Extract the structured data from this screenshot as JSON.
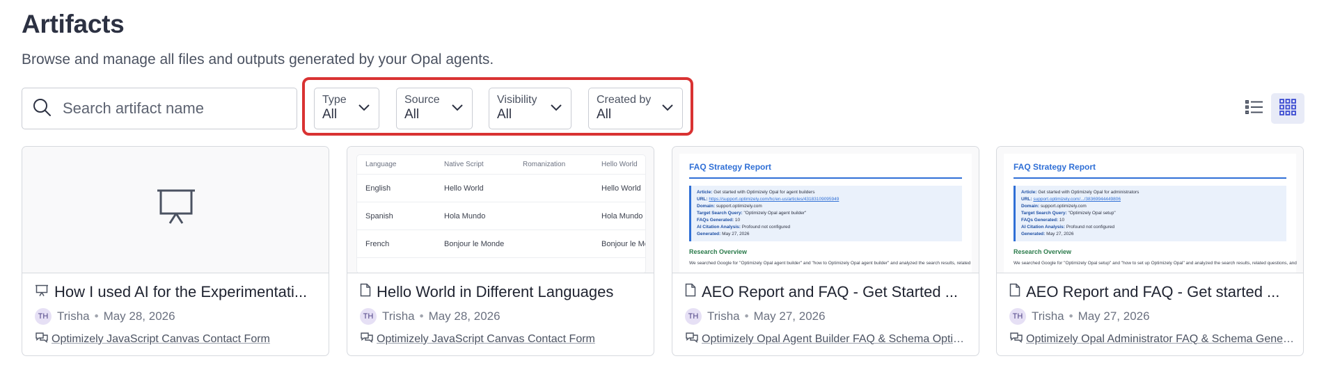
{
  "header": {
    "title": "Artifacts",
    "subtitle": "Browse and manage all files and outputs generated by your Opal agents."
  },
  "search": {
    "placeholder": "Search artifact name",
    "value": ""
  },
  "filters": [
    {
      "label": "Type",
      "value": "All"
    },
    {
      "label": "Source",
      "value": "All"
    },
    {
      "label": "Visibility",
      "value": "All"
    },
    {
      "label": "Created by",
      "value": "All"
    }
  ],
  "view_toggle": {
    "active": "grid",
    "icons": [
      "list-view-icon",
      "grid-view-icon"
    ]
  },
  "accent_colors": {
    "highlight": "#d93232",
    "report_blue": "#2f6fd6",
    "report_green": "#2a7a4a",
    "avatar_bg": "#e6e0f5"
  },
  "cards": [
    {
      "title": "How I used AI for the Experimentati...",
      "type_icon": "presentation-icon",
      "author_initials": "TH",
      "author": "Trisha",
      "date": "May 28, 2026",
      "project": "Optimizely JavaScript Canvas Contact Form",
      "preview": "presentation-icon"
    },
    {
      "title": "Hello World in Different Languages",
      "type_icon": "document-icon",
      "author_initials": "TH",
      "author": "Trisha",
      "date": "May 28, 2026",
      "project": "Optimizely JavaScript Canvas Contact Form",
      "preview_table": {
        "headers": [
          "Language",
          "Native Script",
          "Romanization",
          "Hello World"
        ],
        "rows": [
          [
            "English",
            "Hello World",
            "",
            "Hello World"
          ],
          [
            "Spanish",
            "Hola Mundo",
            "",
            "Hola Mundo"
          ],
          [
            "French",
            "Bonjour le Monde",
            "",
            "Bonjour le Mo"
          ]
        ]
      }
    },
    {
      "title": "AEO Report and FAQ - Get Started ...",
      "type_icon": "document-icon",
      "author_initials": "TH",
      "author": "Trisha",
      "date": "May 27, 2026",
      "project": "Optimizely Opal Agent Builder FAQ & Schema Optimi...",
      "preview_report": {
        "title": "FAQ Strategy Report",
        "article_label": "Article:",
        "article": "Get started with Optimizely Opal for agent builders",
        "url_label": "URL:",
        "url": "https://support.optimizely.com/hc/en-us/articles/43183109095949",
        "domain_label": "Domain:",
        "domain": "support.optimizely.com",
        "query_label": "Target Search Query:",
        "query": "\"Optimizely Opal agent builder\"",
        "faqs_label": "FAQs Generated:",
        "faqs": "10",
        "citation_label": "AI Citation Analysis:",
        "citation": "Profound not configured",
        "generated_label": "Generated:",
        "generated": "May 27, 2026",
        "section": "Research Overview",
        "para": "We searched Google for \"Optimizely Opal agent builder\" and \"how to Optimizely Opal agent builder\" and analyzed the search results, related"
      }
    },
    {
      "title": "AEO Report and FAQ - Get started ...",
      "type_icon": "document-icon",
      "author_initials": "TH",
      "author": "Trisha",
      "date": "May 27, 2026",
      "project": "Optimizely Opal Administrator FAQ & Schema Gener...",
      "preview_report": {
        "title": "FAQ Strategy Report",
        "article_label": "Article:",
        "article": "Get started with Optimizely Opal for administrators",
        "url_label": "URL:",
        "url": "support.optimizely.com/.../38369944449806",
        "domain_label": "Domain:",
        "domain": "support.optimizely.com",
        "query_label": "Target Search Query:",
        "query": "\"Optimizely Opal setup\"",
        "faqs_label": "FAQs Generated:",
        "faqs": "10",
        "citation_label": "AI Citation Analysis:",
        "citation": "Profound not configured",
        "generated_label": "Generated:",
        "generated": "May 27, 2026",
        "section": "Research Overview",
        "para": "We searched Google for \"Optimizely Opal setup\" and \"how to set up Optimizely Opal\" and analyzed the search results, related questions, and"
      }
    }
  ]
}
